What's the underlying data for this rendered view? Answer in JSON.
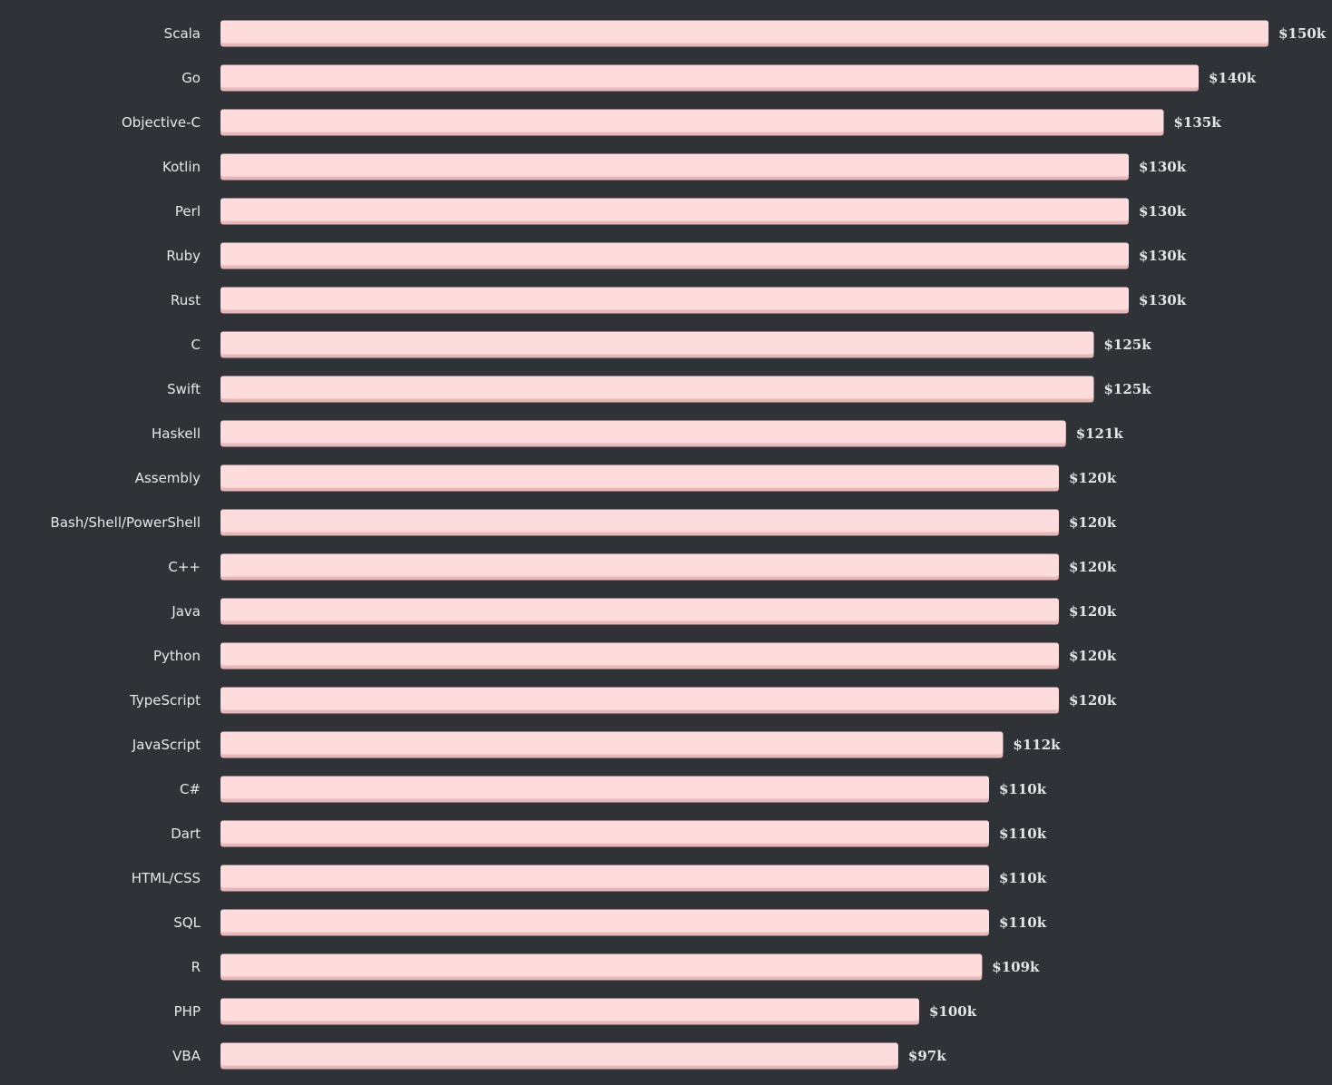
{
  "colors": {
    "background": "#2f3237",
    "bar_fill": "#ffdcdc",
    "bar_shadow": "#e8b8b8",
    "text": "#e8e8e8"
  },
  "chart_data": {
    "type": "bar",
    "orientation": "horizontal",
    "title": "",
    "xlabel": "",
    "ylabel": "",
    "xlim": [
      0,
      150
    ],
    "grid": false,
    "legend": "none",
    "categories": [
      "Scala",
      "Go",
      "Objective-C",
      "Kotlin",
      "Perl",
      "Ruby",
      "Rust",
      "C",
      "Swift",
      "Haskell",
      "Assembly",
      "Bash/Shell/PowerShell",
      "C++",
      "Java",
      "Python",
      "TypeScript",
      "JavaScript",
      "C#",
      "Dart",
      "HTML/CSS",
      "SQL",
      "R",
      "PHP",
      "VBA"
    ],
    "values": [
      150,
      140,
      135,
      130,
      130,
      130,
      130,
      125,
      125,
      121,
      120,
      120,
      120,
      120,
      120,
      120,
      112,
      110,
      110,
      110,
      110,
      109,
      100,
      97
    ],
    "value_labels": [
      "$150k",
      "$140k",
      "$135k",
      "$130k",
      "$130k",
      "$130k",
      "$130k",
      "$125k",
      "$125k",
      "$121k",
      "$120k",
      "$120k",
      "$120k",
      "$120k",
      "$120k",
      "$120k",
      "$112k",
      "$110k",
      "$110k",
      "$110k",
      "$110k",
      "$109k",
      "$100k",
      "$97k"
    ]
  }
}
